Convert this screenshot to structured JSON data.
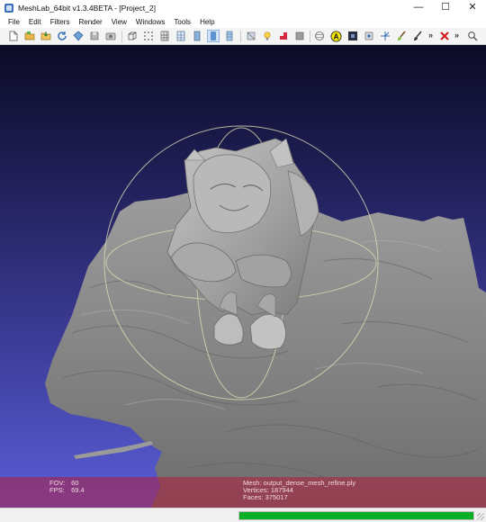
{
  "window": {
    "title": "MeshLab_64bit v1.3.4BETA - [Project_2]",
    "controls": {
      "minimize": "—",
      "maximize": "☐",
      "close": "✕"
    }
  },
  "menu": [
    "File",
    "Edit",
    "Filters",
    "Render",
    "View",
    "Windows",
    "Tools",
    "Help"
  ],
  "toolbar": {
    "icons": [
      "new-project-icon",
      "open-project-icon",
      "import-mesh-icon",
      "reload-icon",
      "export-mesh-icon",
      "save-snapshot-icon",
      "bounding-box-icon",
      "points-icon",
      "wireframe-icon",
      "hidden-lines-icon",
      "flat-shading-icon",
      "smooth-shading-icon",
      "texture-icon",
      "light-icon",
      "vertex-colors-icon",
      "face-colors-icon",
      "trackball-icon",
      "annotation-icon",
      "select-faces-icon",
      "measure-icon",
      "paint-brush-icon",
      "color-brush-icon",
      "delete-icon",
      "zoom-icon"
    ],
    "active": [
      "smooth-shading-icon"
    ],
    "overflow": "»",
    "annotation_letter": "A",
    "colors": {
      "active_bg": "#cfe3f7",
      "light": "#ffd24a",
      "vertex_colors": "#d7263d",
      "delete": "#d01818"
    }
  },
  "viewport": {
    "colors": {
      "bg_top": "#0b0b26",
      "bg_bottom": "#5b5ed6",
      "mesh": "#8a8a8a",
      "trackball": "#dcdcb4",
      "hud_bg": "#af1e3c"
    },
    "hud": {
      "fov_label": "FOV:",
      "fov_value": "60",
      "fps_label": "FPS:",
      "fps_value": "69.4",
      "mesh_label": "Mesh:",
      "mesh_value": "output_dense_mesh_refine.ply",
      "vertices_label": "Vertices:",
      "vertices_value": "187944",
      "faces_label": "Faces:",
      "faces_value": "375017"
    }
  },
  "statusbar": {
    "progress_percent": 100,
    "progress_color": "#06b025"
  }
}
